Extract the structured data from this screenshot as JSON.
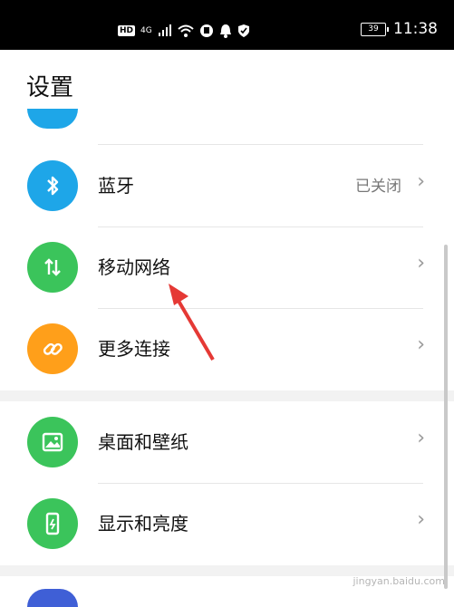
{
  "status_bar": {
    "hd": "HD",
    "signal": "4G",
    "battery": "39",
    "time": "11:38"
  },
  "page": {
    "title": "设置"
  },
  "rows": [
    {
      "label": "蓝牙",
      "value": "已关闭",
      "icon_color": "#1ea6e8",
      "icon": "bluetooth-icon"
    },
    {
      "label": "移动网络",
      "value": "",
      "icon_color": "#3bc45b",
      "icon": "mobile-network-icon"
    },
    {
      "label": "更多连接",
      "value": "",
      "icon_color": "#ff9f1a",
      "icon": "link-icon"
    },
    {
      "label": "桌面和壁纸",
      "value": "",
      "icon_color": "#3bc45b",
      "icon": "wallpaper-icon"
    },
    {
      "label": "显示和亮度",
      "value": "",
      "icon_color": "#3bc45b",
      "icon": "display-icon"
    }
  ],
  "watermark": "jingyan.baidu.com"
}
